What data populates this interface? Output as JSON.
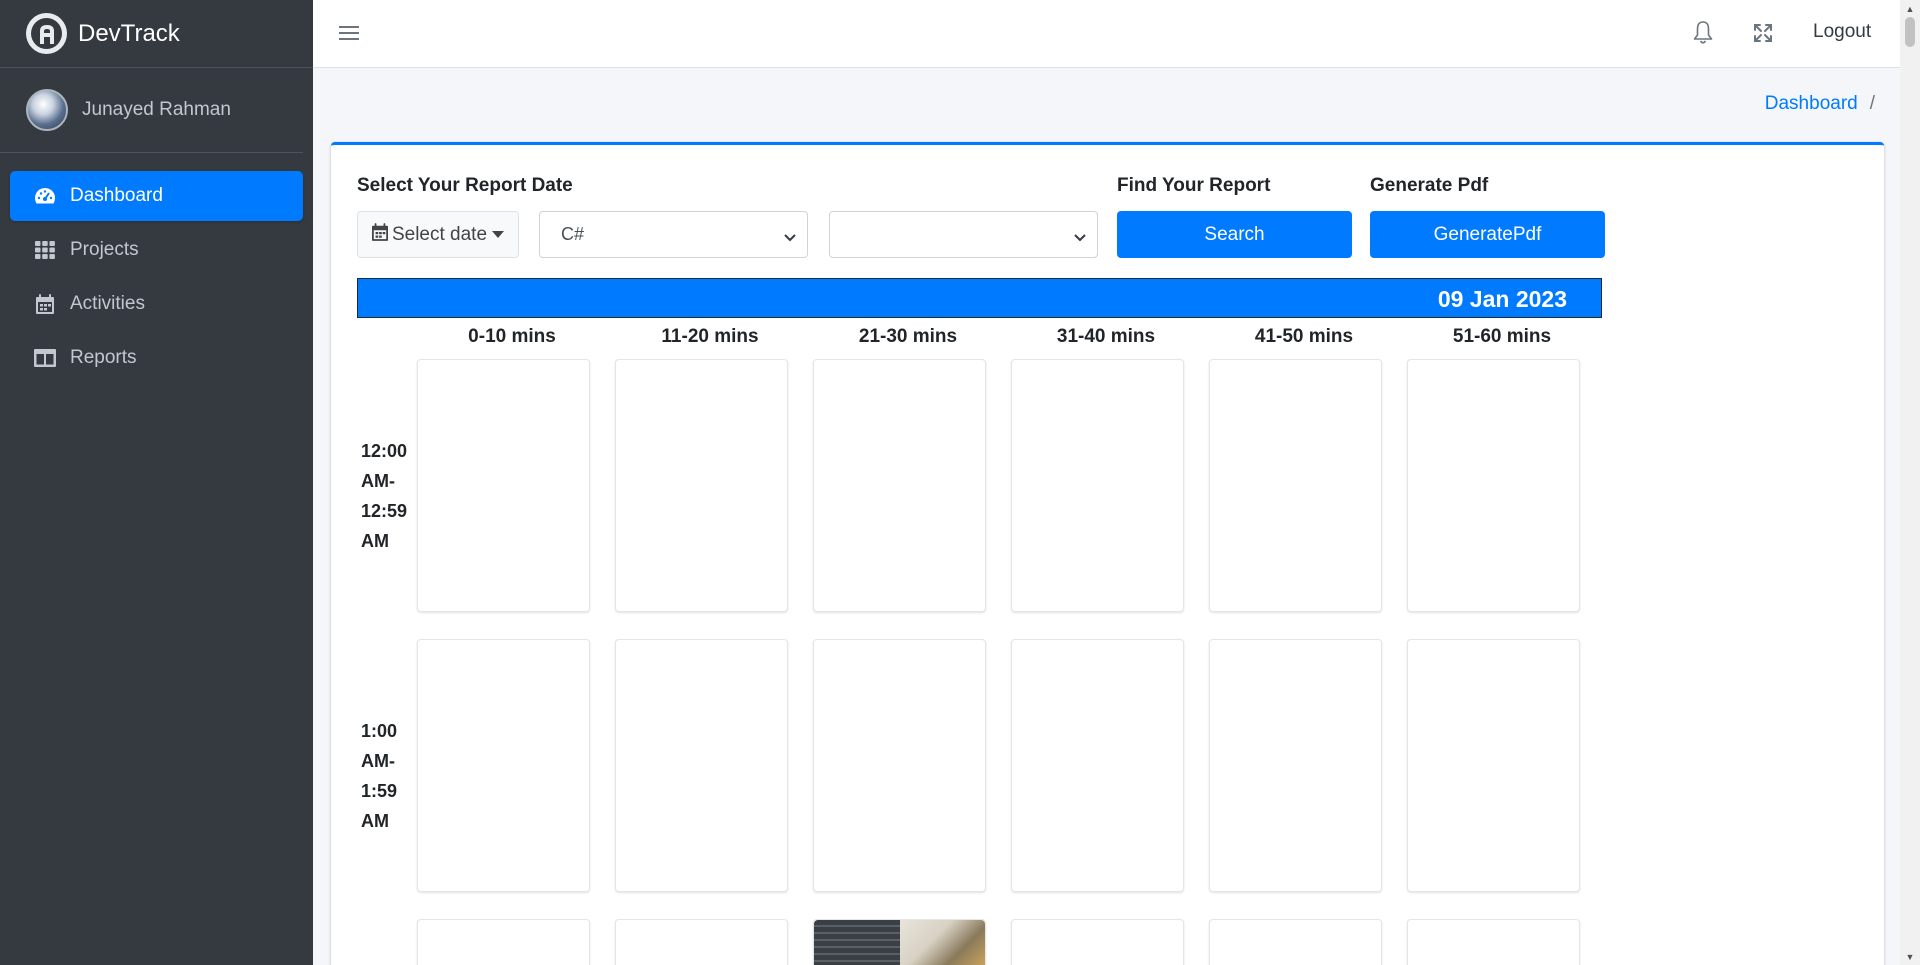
{
  "brand": {
    "name": "DevTrack"
  },
  "user": {
    "name": "Junayed Rahman"
  },
  "sidebar": {
    "items": [
      {
        "label": "Dashboard",
        "icon": "dashboard-gauge-icon",
        "active": true
      },
      {
        "label": "Projects",
        "icon": "grid-icon",
        "active": false
      },
      {
        "label": "Activities",
        "icon": "calendar-icon",
        "active": false
      },
      {
        "label": "Reports",
        "icon": "columns-icon",
        "active": false
      }
    ]
  },
  "topbar": {
    "logout_label": "Logout"
  },
  "breadcrumb": {
    "current": "Dashboard",
    "separator": "/"
  },
  "form": {
    "date_section_label": "Select Your Report Date",
    "date_button_label": "Select date",
    "project_select_value": "C#",
    "second_select_value": "",
    "find_label": "Find Your Report",
    "search_button_label": "Search",
    "generate_label": "Generate Pdf",
    "generate_button_label": "GeneratePdf"
  },
  "report": {
    "date_banner": "09 Jan 2023",
    "columns": [
      "0-10 mins",
      "11-20 mins",
      "21-30 mins",
      "31-40 mins",
      "41-50 mins",
      "51-60 mins"
    ],
    "rows": [
      {
        "label_lines": [
          "12:00",
          "AM-",
          "12:59",
          "AM"
        ]
      },
      {
        "label_lines": [
          "1:00",
          "AM-",
          "1:59",
          "AM"
        ]
      }
    ]
  },
  "colors": {
    "primary": "#007bff",
    "sidebar_bg": "#343a40",
    "sidebar_text": "#c2c7d0"
  }
}
